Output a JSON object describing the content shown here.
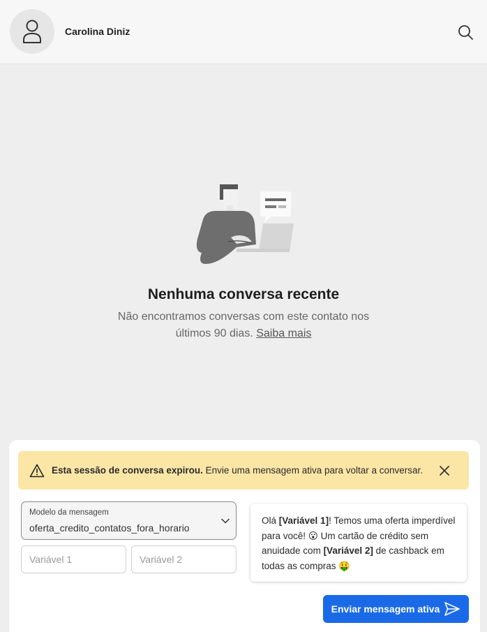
{
  "header": {
    "contact_name": "Carolina Diniz",
    "avatar_icon": "user-icon",
    "search_icon": "search-icon"
  },
  "empty_state": {
    "title": "Nenhuma conversa recente",
    "description": "Não encontramos conversas com este contato nos últimos 90 dias.",
    "link": "Saiba mais"
  },
  "alert": {
    "icon": "warning-icon",
    "bold_text": "Esta sessão de conversa expirou.",
    "text": "Envie uma mensagem ativa para voltar a conversar.",
    "close_icon": "close-icon",
    "color": "#fbe6a6"
  },
  "composer": {
    "template_label": "Modelo da mensagem",
    "template_value": "oferta_credito_contatos_fora_horario",
    "variable1_placeholder": "Variável 1",
    "variable2_placeholder": "Variável 2",
    "preview": {
      "p1": "Olá ",
      "var1": "[Variável 1]",
      "p2": "! Temos uma oferta imperdível para você! 😮 Um cartão de crédito sem anuidade com ",
      "var2": "[Variável 2]",
      "p3": " de cashback em todas as compras 🤑"
    },
    "send_label": "Enviar mensagem ativa",
    "send_icon": "send-icon",
    "accent_color": "#1a6ae8"
  }
}
